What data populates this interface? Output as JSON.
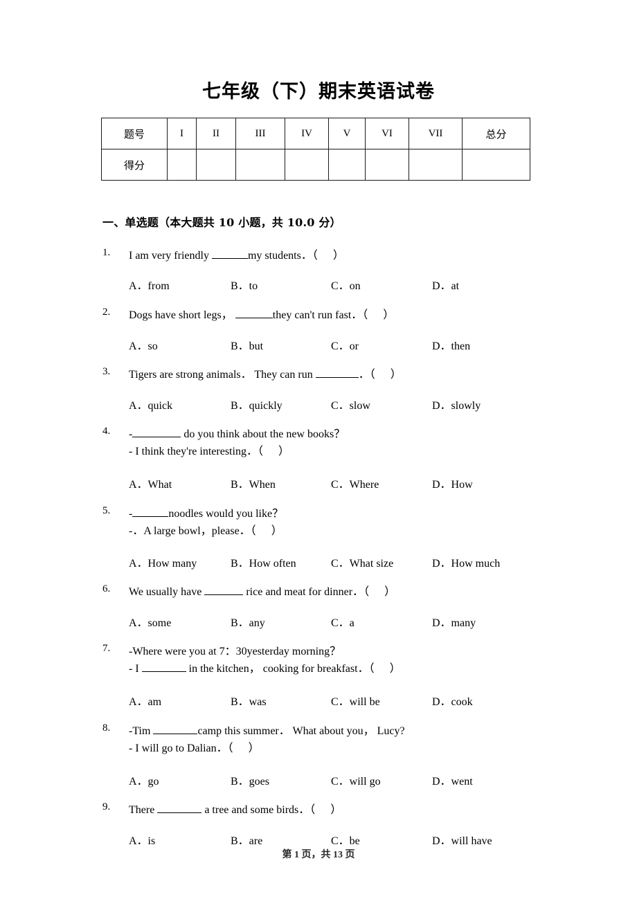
{
  "document": {
    "title": "七年级（下）期末英语试卷",
    "footer": "第 1 页，共 13 页"
  },
  "score_table": {
    "row_labels": [
      "题号",
      "得分"
    ],
    "columns": [
      "I",
      "II",
      "III",
      "IV",
      "V",
      "VI",
      "VII",
      "总分"
    ],
    "scores": [
      "",
      "",
      "",
      "",
      "",
      "",
      "",
      ""
    ]
  },
  "sections": [
    {
      "heading": "一、单选题（本大题共 10 小题，共 10.0 分）"
    }
  ],
  "questions": [
    {
      "number": "1.",
      "lines": [
        "I am very friendly ______my students．（      ）"
      ],
      "stem_pre": "I am very friendly ",
      "stem_post": "my students．",
      "options": [
        "A．from",
        "B．to",
        "C．on",
        "D．at"
      ]
    },
    {
      "number": "2.",
      "lines": [
        "Dogs have short legs，______they can't run fast．（      ）"
      ],
      "stem_pre": "Dogs have short legs，  ",
      "stem_post": "they can't run fast．",
      "options": [
        "A．so",
        "B．but",
        "C．or",
        "D．then"
      ]
    },
    {
      "number": "3.",
      "lines": [
        "Tigers are strong animals．They can run _______．（      ）"
      ],
      "stem_pre": "Tigers are strong animals．  They can run ",
      "stem_post": "．",
      "options": [
        "A．quick",
        "B．quickly",
        "C．slow",
        "D．slowly"
      ]
    },
    {
      "number": "4.",
      "lines": [
        "-________ do you think about the new books？",
        "- I think they're interesting．（      ）"
      ],
      "stem_pre": "-",
      "stem_post": " do you think about the new books？",
      "line2": "- I think they're interesting．",
      "options": [
        "A．What",
        "B．When",
        "C．Where",
        "D．How"
      ]
    },
    {
      "number": "5.",
      "lines": [
        "-______noodles would you like？",
        "-．A large bowl，please．（      ）"
      ],
      "stem_pre": "-",
      "stem_post": "noodles would you like？",
      "line2": "-．A large bowl，please．",
      "options": [
        "A．How many",
        "B．How often",
        "C．What size",
        "D．How much"
      ]
    },
    {
      "number": "6.",
      "lines": [
        "We usually have ______ rice and meat for dinner．（      ）"
      ],
      "stem_pre": "We usually have ",
      "stem_post": " rice and meat for dinner．",
      "options": [
        "A．some",
        "B．any",
        "C．a",
        "D．many"
      ]
    },
    {
      "number": "7.",
      "lines": [
        "-Where were you at 7：30yesterday morning？",
        "- I _______ in the kitchen，cooking for breakfast．（      ）"
      ],
      "line1": "-Where were you at 7：30yesterday morning？",
      "stem_pre": "- I ",
      "stem_post": " in the kitchen，  cooking for breakfast．",
      "options": [
        "A．am",
        "B．was",
        "C．will be",
        "D．cook"
      ]
    },
    {
      "number": "8.",
      "lines": [
        "-Tim _______camp this summer．What about you，Lucy?",
        "- I will go to Dalian．（      ）"
      ],
      "stem_pre": "-Tim ",
      "stem_post": "camp this summer．  What about you，  Lucy?",
      "line2": "- I will go to Dalian．",
      "options": [
        "A．go",
        "B．goes",
        "C．will go",
        "D．went"
      ]
    },
    {
      "number": "9.",
      "lines": [
        "There _______ a tree and some birds．（      ）"
      ],
      "stem_pre": "There ",
      "stem_post": " a tree and some birds．",
      "options": [
        "A．is",
        "B．are",
        "C．be",
        "D．will have"
      ]
    }
  ]
}
